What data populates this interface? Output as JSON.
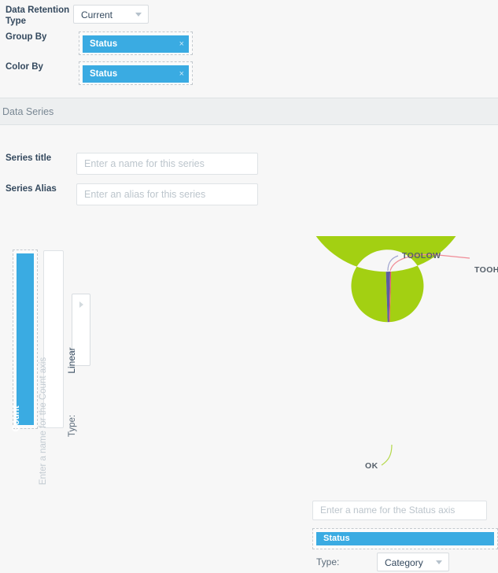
{
  "form": {
    "retention": {
      "label": "Data Retention Type",
      "value": "Current"
    },
    "group_by": {
      "label": "Group By",
      "tag": "Status",
      "remove_icon": "×"
    },
    "color_by": {
      "label": "Color By",
      "tag": "Status",
      "remove_icon": "×"
    }
  },
  "section": {
    "title": "Data Series"
  },
  "series": {
    "title_label": "Series title",
    "title_placeholder": "Enter a name for this series",
    "title_value": "",
    "alias_label": "Series Alias",
    "alias_placeholder": "Enter an alias for this series",
    "alias_value": ""
  },
  "value_axis": {
    "tag": "Count",
    "name_placeholder": "Enter a name for the Count axis",
    "name_value": "",
    "type_label": "Type:",
    "type_value": "Linear"
  },
  "category_axis": {
    "name_placeholder": "Enter a name for the Status axis",
    "name_value": "",
    "tag": "Status",
    "type_label": "Type:",
    "type_value": "Category"
  },
  "colors": {
    "accent_blue": "#3aabe2",
    "ok_green": "#a3d012",
    "toolow_purple": "#5b5ea0",
    "toohigh_red": "#ed5565",
    "band_grey": "#edeff0",
    "page_grey": "#f7f7f7"
  },
  "chart_data": {
    "type": "pie",
    "title": "",
    "variant": "donut",
    "categories": [
      "OK",
      "TOOLOW",
      "TOOHIGH"
    ],
    "values": [
      97.7,
      2.0,
      0.3
    ],
    "colors": [
      "#a3d012",
      "#5b5ea0",
      "#ed5565"
    ],
    "labels": [
      "OK",
      "TOOLOW",
      "TOOHIGH"
    ],
    "legend": "none",
    "label_placement": "outside-with-leader-lines",
    "inner_radius_ratio": 0.42,
    "start_angle_deg": 0,
    "xlabel": "Status",
    "ylabel": "Count"
  }
}
